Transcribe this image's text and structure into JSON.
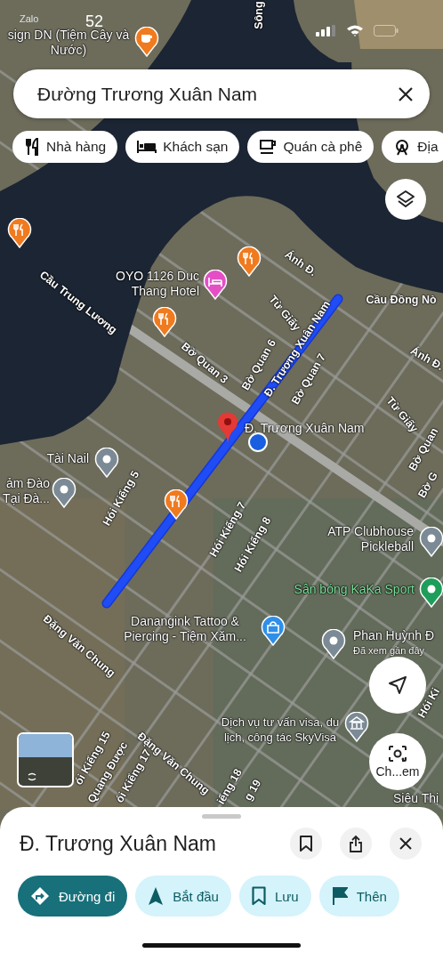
{
  "status_bar": {
    "time": "52",
    "back_app": "Zalo"
  },
  "search": {
    "value": "Đường Trương Xuân Nam"
  },
  "chips": [
    {
      "label": "Nhà hàng",
      "kind": "restaurant"
    },
    {
      "label": "Khách sạn",
      "kind": "hotel"
    },
    {
      "label": "Quán cà phê",
      "kind": "cafe"
    },
    {
      "label": "Địa",
      "kind": "attraction"
    }
  ],
  "map": {
    "pois": [
      {
        "name": "sign DN (Tiệm Cây và Nước)",
        "kind": "cafe"
      },
      {
        "kind": "restaurant"
      },
      {
        "kind": "restaurant"
      },
      {
        "name": "OYO 1126 Duc Thang Hotel",
        "kind": "hotel"
      },
      {
        "kind": "restaurant"
      },
      {
        "name": "Tài Nail",
        "kind": "place"
      },
      {
        "name": "ảm Đào Tại Đà...",
        "kind": "place"
      },
      {
        "kind": "restaurant"
      },
      {
        "name": "ATP Clubhouse Pickleball",
        "kind": "place"
      },
      {
        "name": "Sân bóng KaKa Sport",
        "kind": "sport"
      },
      {
        "name": "Danangink Tattoo & Piercing - Tiệm Xăm...",
        "kind": "shop"
      },
      {
        "name": "Phan Huỳnh Đ",
        "note": "Đã xem gần đây",
        "kind": "place"
      },
      {
        "name": "Dịch vụ tư vấn visa, du lịch, công tác SkyVisa",
        "kind": "landmark"
      },
      {
        "name": "Siêu Thị",
        "kind": "offscreen"
      }
    ],
    "selected_place_label": "Đ. Trương Xuân Nam",
    "streets": [
      "Sông",
      "Cầu Trung Lương",
      "Ánh Đ.",
      "Cầu Đồng Nò",
      "Ánh Đ.",
      "Từ Giấy",
      "Bờ Quan 3",
      "Bờ Quan 6",
      "Bờ Quan 7",
      "Đ. Trương Xuân Nam",
      "Từ Giấy",
      "Bờ Quan",
      "Bờ G",
      "Hói Kiểng 5",
      "Hói Kiểng 7",
      "Hói Kiểng 8",
      "Đặng Văn Chung",
      "Đặng Văn Chung",
      "ói Kiểng 15",
      "Quang Được",
      "ói Kiểng 17",
      "iểng 18",
      "g 19",
      "Hói Ki"
    ],
    "lens_label": "Ch...em"
  },
  "place_sheet": {
    "title": "Đ. Trương Xuân Nam",
    "actions": [
      {
        "label": "Đường đi",
        "kind": "directions"
      },
      {
        "label": "Bắt đầu",
        "kind": "start"
      },
      {
        "label": "Lưu",
        "kind": "save"
      },
      {
        "label": "Thên",
        "kind": "label"
      }
    ]
  }
}
